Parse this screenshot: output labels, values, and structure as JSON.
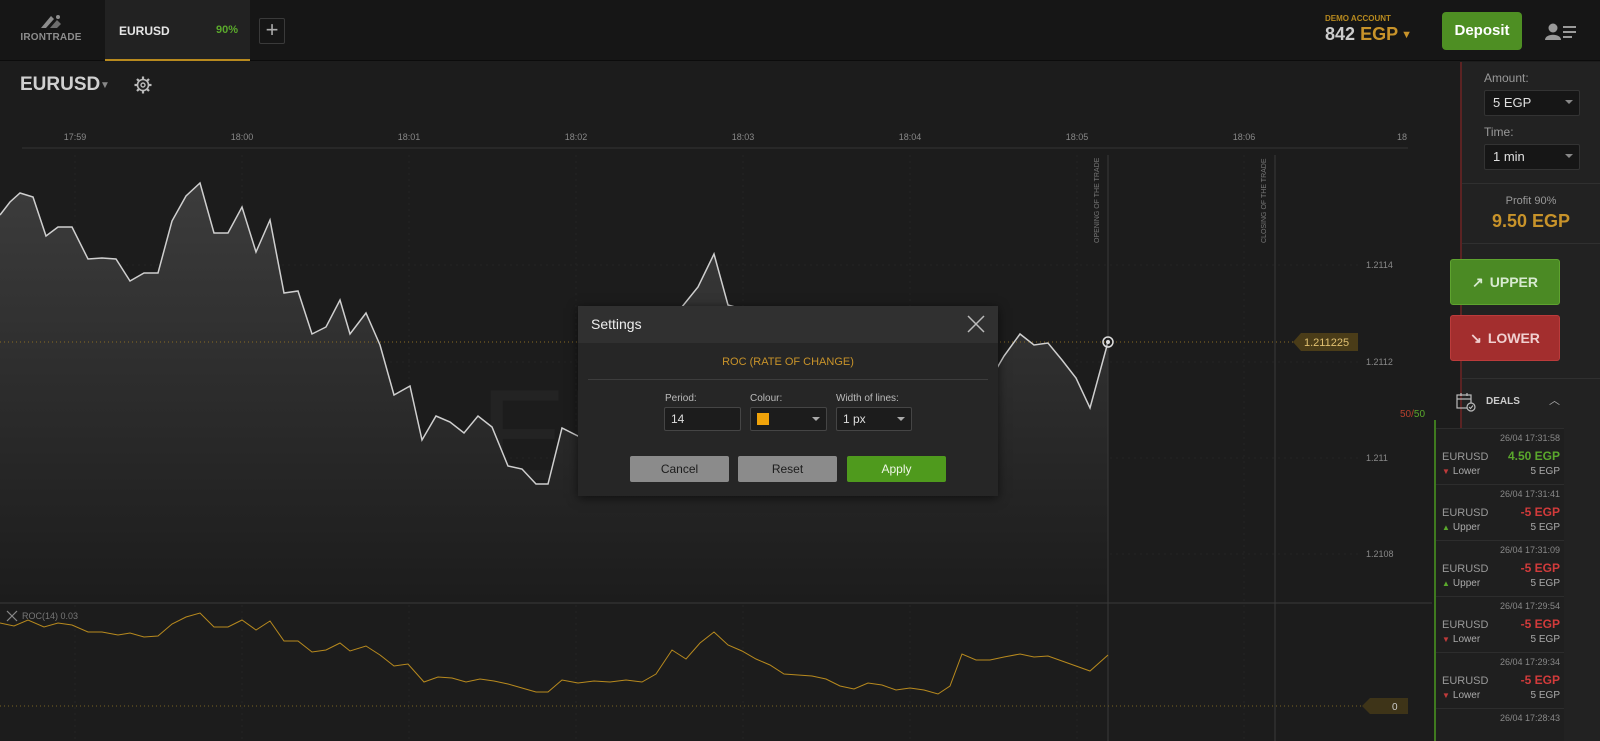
{
  "logo": {
    "text": "IRONTRADE"
  },
  "tabs": [
    {
      "label": "EURUSD",
      "payout": "90%"
    }
  ],
  "account": {
    "label": "DEMO ACCOUNT",
    "balance": "842",
    "currency": "EGP"
  },
  "header": {
    "deposit_label": "Deposit"
  },
  "chart": {
    "asset": "EURUSD",
    "time_labels": [
      "17:59",
      "18:00",
      "18:01",
      "18:02",
      "18:03",
      "18:04",
      "18:05",
      "18:06",
      "18"
    ],
    "price_labels": [
      "1.2114",
      "1.2112",
      "1.211",
      "1.2108"
    ],
    "current_price": "1.211225",
    "watermark": "EU",
    "opening_label": "OPENING OF THE TRADE",
    "closing_label": "CLOSING OF THE TRADE",
    "ratio_a": "50",
    "ratio_b": "50",
    "indicator_label": "ROC(14) 0.03",
    "indicator_zero": "0",
    "accent": "#c8932a",
    "line_color": "#d0d0d0",
    "indicator_color": "#b88a1e"
  },
  "panel": {
    "amount_label": "Amount:",
    "amount_value": "5 EGP",
    "time_label": "Time:",
    "time_value": "1 min",
    "profit_label": "Profit 90%",
    "profit_value": "9.50 EGP",
    "upper_label": "UPPER",
    "lower_label": "LOWER",
    "deals_label": "DEALS"
  },
  "deals": [
    {
      "time": "26/04 17:31:58",
      "asset": "EURUSD",
      "result": "4.50 EGP",
      "direction": "Lower",
      "amount": "5 EGP",
      "win": true
    },
    {
      "time": "26/04 17:31:41",
      "asset": "EURUSD",
      "result": "-5 EGP",
      "direction": "Upper",
      "amount": "5 EGP",
      "win": false
    },
    {
      "time": "26/04 17:31:09",
      "asset": "EURUSD",
      "result": "-5 EGP",
      "direction": "Upper",
      "amount": "5 EGP",
      "win": false
    },
    {
      "time": "26/04 17:29:54",
      "asset": "EURUSD",
      "result": "-5 EGP",
      "direction": "Lower",
      "amount": "5 EGP",
      "win": false
    },
    {
      "time": "26/04 17:29:34",
      "asset": "EURUSD",
      "result": "-5 EGP",
      "direction": "Lower",
      "amount": "5 EGP",
      "win": false
    },
    {
      "time": "26/04 17:28:43",
      "asset": "",
      "result": "",
      "direction": "",
      "amount": "",
      "win": false
    }
  ],
  "modal": {
    "title": "Settings",
    "subtitle": "ROC (RATE OF CHANGE)",
    "period_label": "Period:",
    "period_value": "14",
    "colour_label": "Colour:",
    "colour_value": "#f0a30a",
    "width_label": "Width of lines:",
    "width_value": "1 px",
    "cancel_label": "Cancel",
    "reset_label": "Reset",
    "apply_label": "Apply"
  }
}
